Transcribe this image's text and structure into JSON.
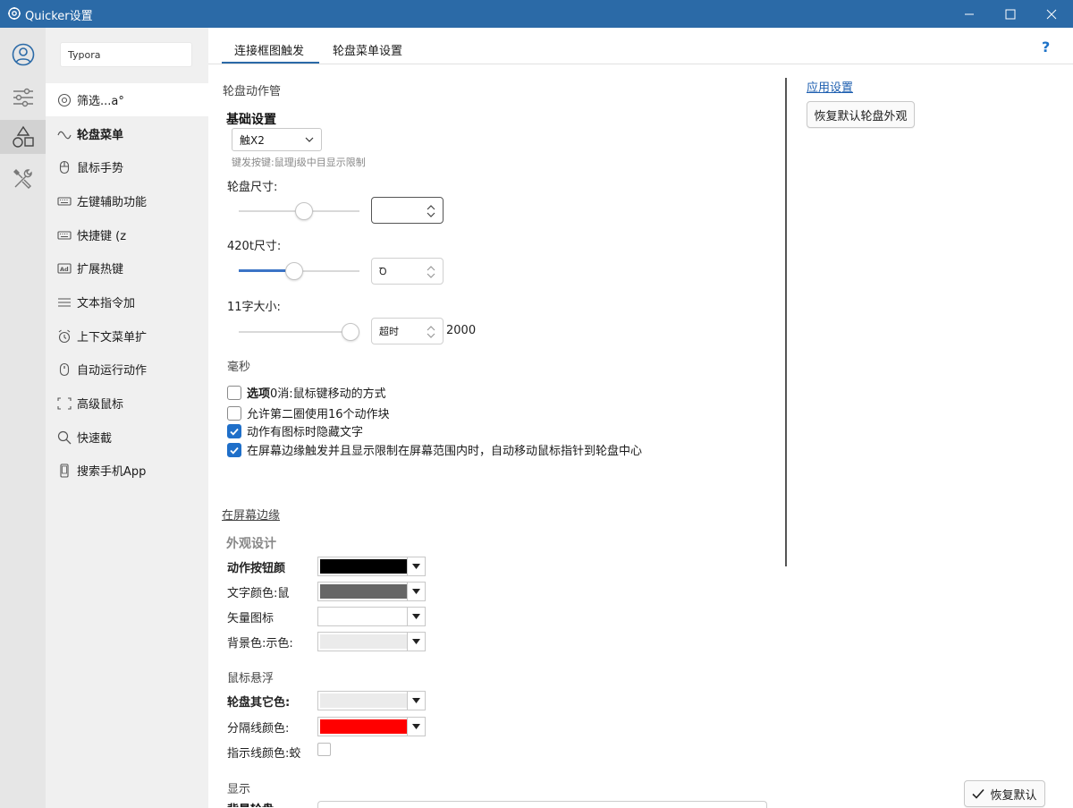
{
  "window": {
    "title": "Quicker设置",
    "icon": "gear-atom-icon"
  },
  "rail": {
    "items": [
      {
        "icon": "user-icon"
      },
      {
        "icon": "sliders-icon"
      },
      {
        "icon": "shapes-icon"
      },
      {
        "icon": "tools-icon"
      }
    ]
  },
  "sidebar": {
    "search_value": "Typora",
    "items": [
      {
        "label": "筛选...a°",
        "icon": "target-icon"
      },
      {
        "label": "轮盘菜单",
        "icon": "wave-icon"
      },
      {
        "label": "鼠标手势",
        "icon": "mouse-icon"
      },
      {
        "label": "左键辅助功能",
        "icon": "keyboard-icon"
      },
      {
        "label": "快捷键 (z",
        "icon": "keyboard-icon"
      },
      {
        "label": "扩展热键",
        "icon": "ad-icon"
      },
      {
        "label": "文本指令加",
        "icon": "menu-lines-icon"
      },
      {
        "label": "上下文菜单扩",
        "icon": "alarm-icon"
      },
      {
        "label": "自动运行动作",
        "icon": "mouse-icon"
      },
      {
        "label": "高级鼠标",
        "icon": "bracket-icon"
      },
      {
        "label": "快速截",
        "icon": "search-icon"
      },
      {
        "label": "搜索手机App",
        "icon": "phone-icon"
      }
    ]
  },
  "tabs": [
    {
      "label": "连接框图触发"
    },
    {
      "label": "轮盘菜单设置"
    }
  ],
  "help_label": "?",
  "main": {
    "section1_title": "轮盘动作管",
    "basic_title": "基础设置",
    "trigger_combo": "触X2",
    "hint": "键发按键:鼠理j级中目显示限制",
    "wheel_size_label": "轮盘尺寸:",
    "wheel_size_value": 0.55,
    "field2_label": "420t尺寸:",
    "field2_value": 0.45,
    "field2_spin": "Ꝺ",
    "font_size_label": "11字大小:",
    "font_size_value": 1.0,
    "font_spin": "超时",
    "font_suffix": "2000",
    "ms_label": "毫秒",
    "checks": [
      {
        "label_bold": "选项",
        "label": "0消:鼠标键移动的方式",
        "checked": false
      },
      {
        "label_bold": "",
        "label": "允许第二圈使用16个动作块",
        "checked": false
      },
      {
        "label_bold": "",
        "label": "动作有图标时隐藏文字",
        "checked": true
      },
      {
        "label_bold": "",
        "label": "在屏幕边缘触发并且显示限制在屏幕范围内时，自动移动鼠标指针到轮盘中心",
        "checked": true
      }
    ],
    "section2_title": "在屏幕边缘",
    "appearance_title": "外观设计",
    "colors": [
      {
        "label": "动作按钮颜",
        "color": "#000000",
        "bold": true
      },
      {
        "label": "文字颜色:鼠",
        "color": "#666666",
        "bold": false
      },
      {
        "label": "矢量图标",
        "color": "#ffffff",
        "bold": false
      },
      {
        "label": "背景色:示色:",
        "color": "#ebebeb",
        "bold": false
      }
    ],
    "hover_title": "鼠标悬浮",
    "hover_colors": [
      {
        "label": "轮盘其它色:",
        "color": "#ebebeb",
        "bold": true
      },
      {
        "label": "分隔线颜色:",
        "color": "#ff0000",
        "bold": false
      }
    ],
    "guide_label": "指示线颜色:蛟",
    "display_title": "显示",
    "bg_label": "背景轮盘"
  },
  "right": {
    "apply_link": "应用设置",
    "restore_btn": "恢复默认轮盘外观"
  },
  "footer": {
    "restore_default": "恢复默认"
  },
  "colors": {
    "accent": "#2b6aa7",
    "check": "#1f6fc9"
  }
}
